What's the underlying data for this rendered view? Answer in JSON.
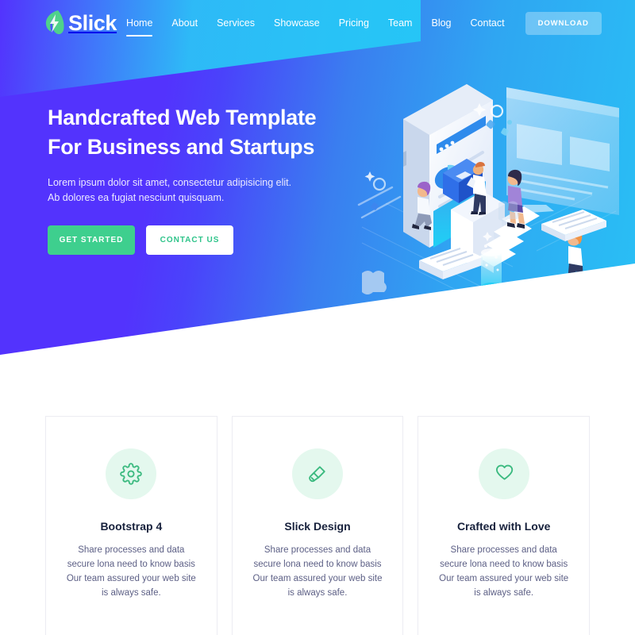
{
  "brand": {
    "name": "Slick",
    "mark": "lightning-leaf-icon"
  },
  "nav": {
    "links": [
      {
        "label": "Home",
        "active": true
      },
      {
        "label": "About",
        "active": false
      },
      {
        "label": "Services",
        "active": false
      },
      {
        "label": "Showcase",
        "active": false
      },
      {
        "label": "Pricing",
        "active": false
      },
      {
        "label": "Team",
        "active": false
      },
      {
        "label": "Blog",
        "active": false
      },
      {
        "label": "Contact",
        "active": false
      }
    ],
    "download_label": "DOWNLOAD"
  },
  "hero": {
    "title_line1": "Handcrafted Web Template",
    "title_line2": "For Business and Startups",
    "subtitle": "Lorem ipsum dolor sit amet, consectetur adipisicing elit. Ab dolores ea fugiat nesciunt quisquam.",
    "primary_cta": "GET STARTED",
    "secondary_cta": "CONTACT US",
    "illustration": "isometric-team-working-illustration"
  },
  "features": [
    {
      "icon": "gear-icon",
      "title": "Bootstrap 4",
      "text": "Share processes and data secure lona need to know basis Our team assured your web site is always safe."
    },
    {
      "icon": "paintbrush-icon",
      "title": "Slick Design",
      "text": "Share processes and data secure lona need to know basis Our team assured your web site is always safe."
    },
    {
      "icon": "heart-icon",
      "title": "Crafted with Love",
      "text": "Share processes and data secure lona need to know basis Our team assured your web site is always safe."
    }
  ],
  "colors": {
    "brand_purple": "#5333fd",
    "brand_cyan": "#29c0f5",
    "accent_green": "#3ecf8e",
    "icon_bg": "#e4f8ee",
    "title_dark": "#17213c",
    "body_text": "#5c5f85"
  }
}
